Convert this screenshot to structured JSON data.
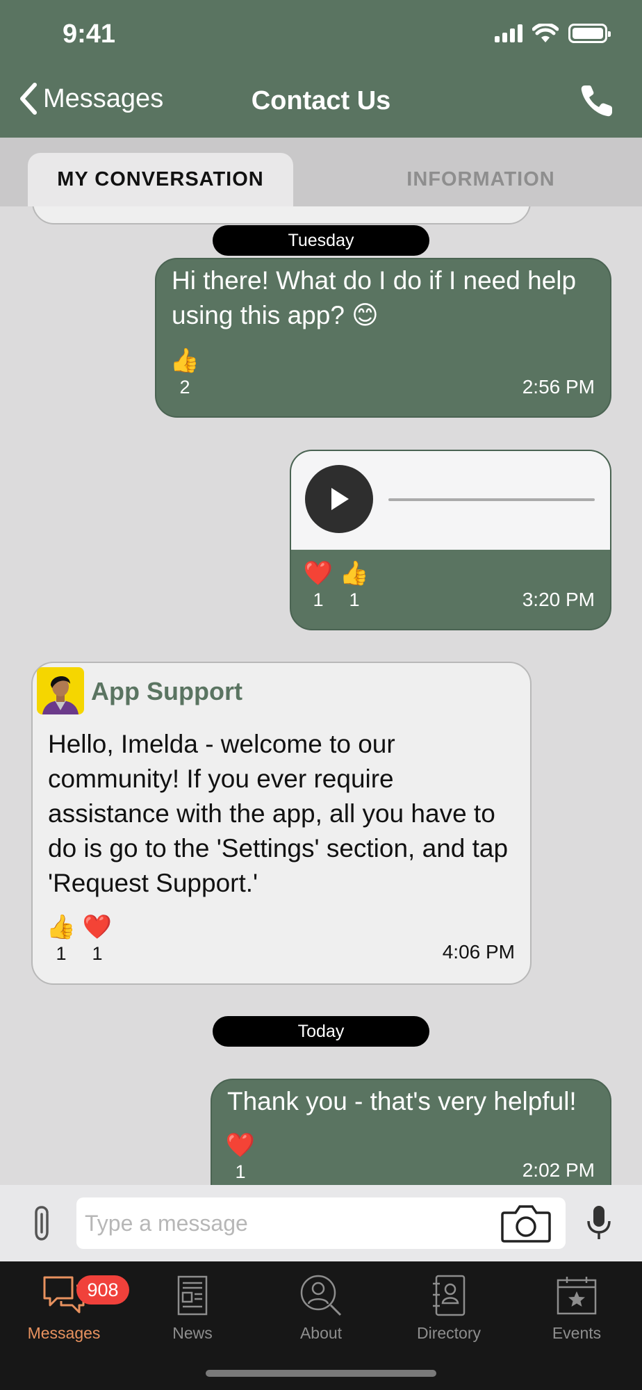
{
  "status_bar": {
    "time": "9:41"
  },
  "header": {
    "back_label": "Messages",
    "title": "Contact Us"
  },
  "tabs": {
    "active": "MY CONVERSATION",
    "inactive": "INFORMATION"
  },
  "conversation": {
    "dates": [
      "Tuesday",
      "Today"
    ],
    "messages": [
      {
        "text": "Hi there! What do I do if I need help using this app? 😊",
        "reactions": [
          {
            "emoji": "👍",
            "count": "2"
          }
        ],
        "time": "2:56 PM"
      },
      {
        "reactions": [
          {
            "emoji": "❤️",
            "count": "1"
          },
          {
            "emoji": "👍",
            "count": "1"
          }
        ],
        "time": "3:20 PM"
      },
      {
        "sender": "App Support",
        "text": "Hello, Imelda - welcome to our community! If you ever require assistance with the app, all you have to do is go to the 'Settings' section, and tap 'Request Support.'",
        "reactions": [
          {
            "emoji": "👍",
            "count": "1"
          },
          {
            "emoji": "❤️",
            "count": "1"
          }
        ],
        "time": "4:06 PM"
      },
      {
        "text": "Thank you - that's very helpful!",
        "reactions": [
          {
            "emoji": "❤️",
            "count": "1"
          }
        ],
        "time": "2:02 PM"
      }
    ]
  },
  "composer": {
    "placeholder": "Type a message"
  },
  "tabbar": {
    "items": [
      {
        "label": "Messages",
        "badge": "908"
      },
      {
        "label": "News"
      },
      {
        "label": "About"
      },
      {
        "label": "Directory"
      },
      {
        "label": "Events"
      }
    ]
  },
  "colors": {
    "primary": "#5a7461",
    "accent": "#e8925f",
    "badge": "#f0413b"
  }
}
